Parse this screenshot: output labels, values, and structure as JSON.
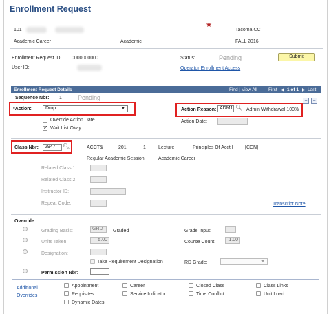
{
  "page": {
    "title": "Enrollment Request"
  },
  "student": {
    "id_prefix": "101",
    "institution": "Tacoma CC",
    "career_label": "Academic Career",
    "career_value": "Academic",
    "term": "FALL 2016"
  },
  "request": {
    "id_label": "Enrollment Request ID:",
    "id_value": "0000000000",
    "user_label": "User ID:",
    "status_label": "Status:",
    "status_value": "Pending",
    "submit_label": "Submit",
    "operator_link": "Operator Enrollment Access"
  },
  "details": {
    "bar_title": "Enrollment Request Details",
    "find": "Find",
    "view_all": "View All",
    "first": "First",
    "range": "1 of 1",
    "last": "Last",
    "seq_label": "Sequence Nbr:",
    "seq_value": "1",
    "seq_status": "Pending",
    "action_label": "*Action:",
    "action_value": "Drop",
    "override_action_date": "Override Action Date",
    "wait_list_okay": "Wait List Okay",
    "action_reason_label": "Action Reason:",
    "action_reason_value": "ADM1",
    "action_reason_desc": "Admin Withdrawal 100%",
    "action_date_label": "Action Date:",
    "class_nbr_label": "Class Nbr:",
    "class_nbr_value": "2947",
    "subject": "ACCT&",
    "catalog": "201",
    "section": "1",
    "component": "Lecture",
    "course_title": "Principles Of Acct I",
    "ccn": "[CCN]",
    "session": "Regular Academic Session",
    "class_career": "Academic Career",
    "related1": "Related Class 1:",
    "related2": "Related Class 2:",
    "instructor": "Instructor ID:",
    "repeat": "Repeat Code:",
    "transcript_note": "Transcript Note"
  },
  "override": {
    "title": "Override",
    "grading_basis_label": "Grading Basis:",
    "grading_basis_code": "GRD",
    "grading_basis_desc": "Graded",
    "units_label": "Units Taken:",
    "units_value": "5.00",
    "designation_label": "Designation:",
    "take_req": "Take Requirement Designation",
    "permission_label": "Permission Nbr:",
    "grade_input_label": "Grade Input:",
    "course_count_label": "Course Count:",
    "course_count_value": "1.00",
    "rd_grade_label": "RD Grade:"
  },
  "additional": {
    "title_line1": "Additional",
    "title_line2": "Overrides",
    "appointment": "Appointment",
    "requisites": "Requisites",
    "dynamic_dates": "Dynamic Dates",
    "career": "Career",
    "service_indicator": "Service Indicator",
    "closed_class": "Closed Class",
    "time_conflict": "Time Conflict",
    "class_links": "Class Links",
    "unit_load": "Unit Load"
  },
  "colors": {
    "title": "#2b4f84",
    "bar": "#4b6c98",
    "highlight": "#e02121",
    "submit": "#fbf6a8"
  }
}
